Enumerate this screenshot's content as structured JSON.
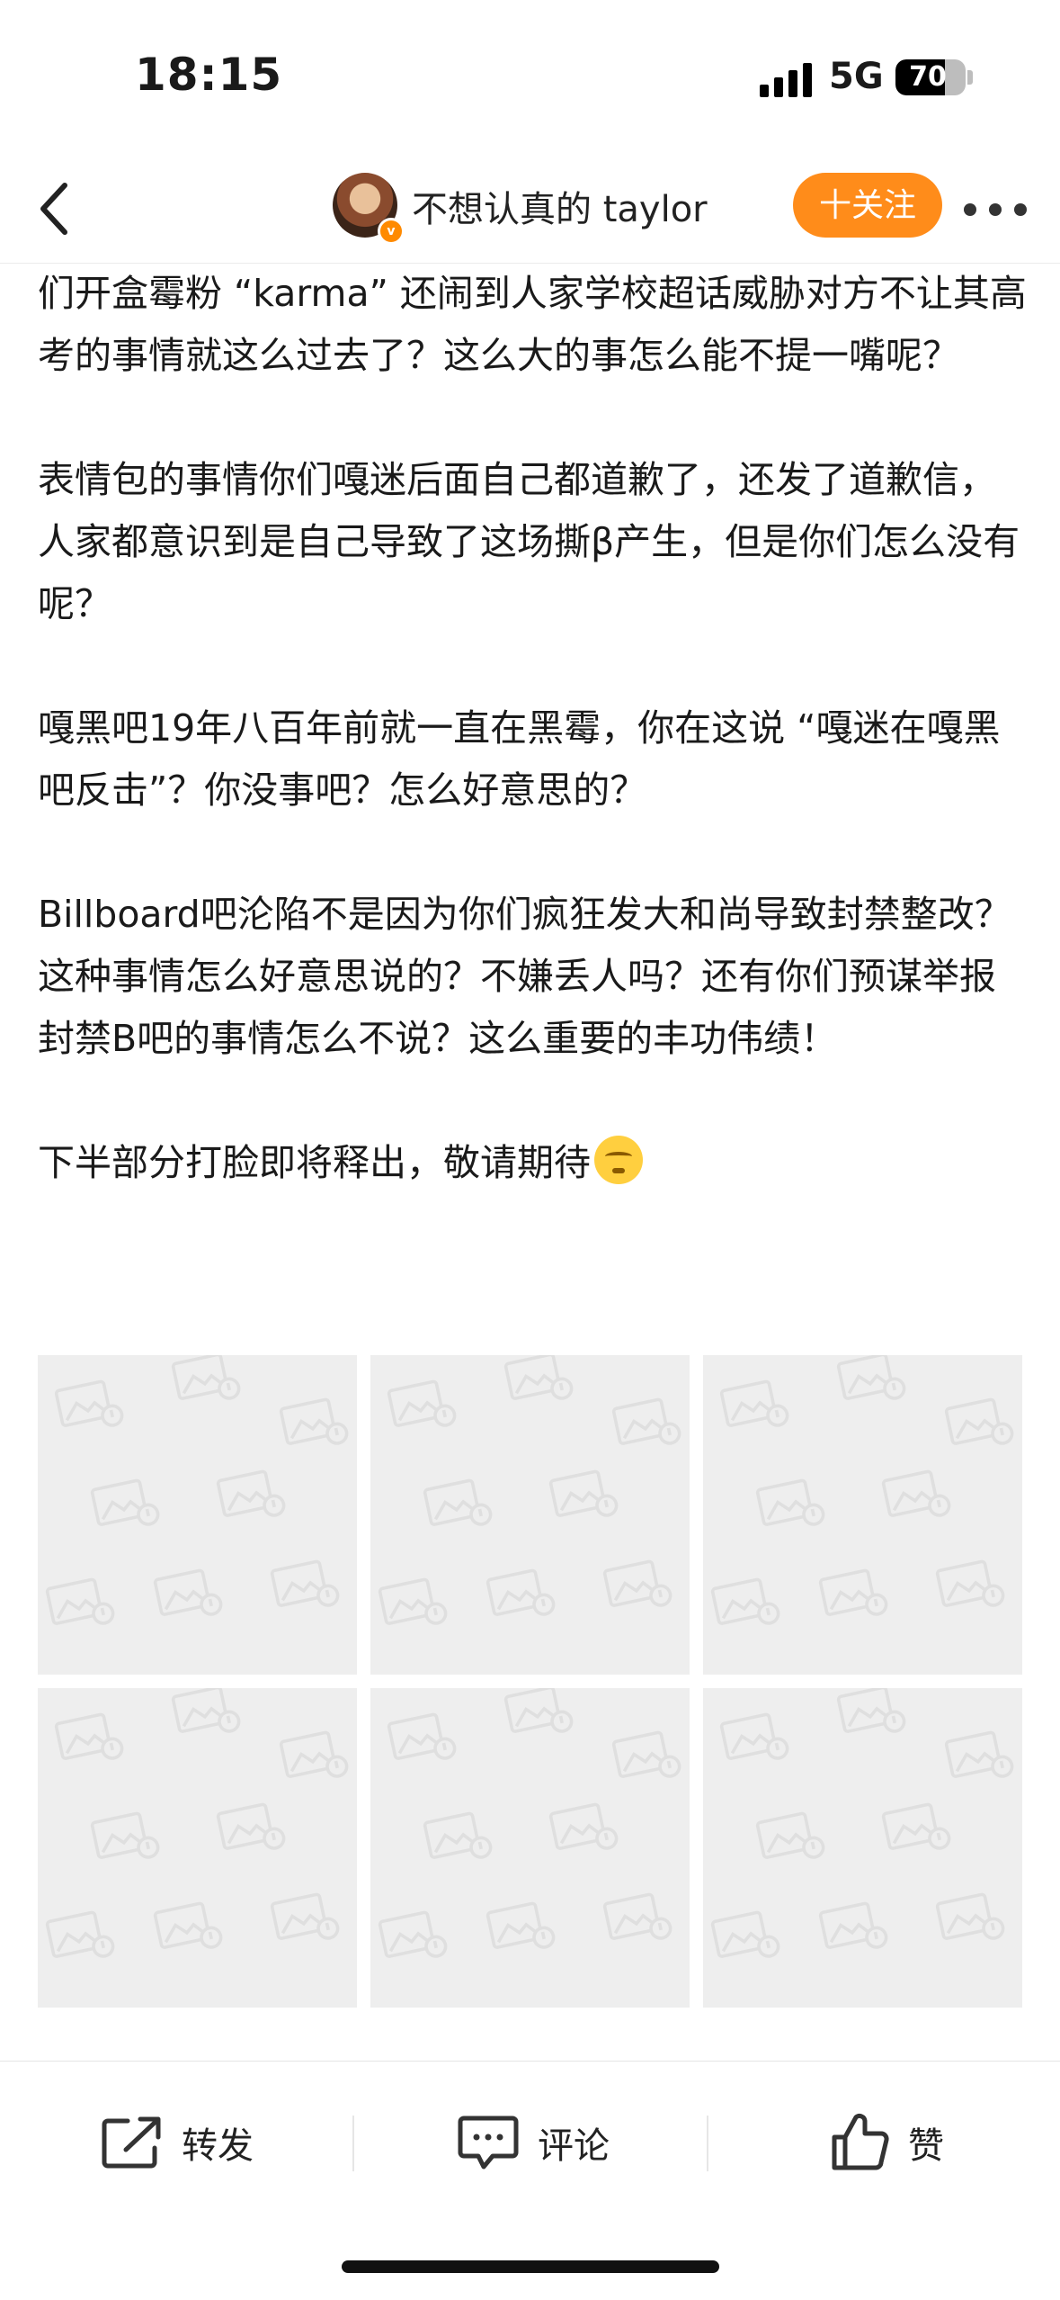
{
  "status_bar": {
    "time": "18:15",
    "network": "5G",
    "battery": "70",
    "battery_level": 0.7
  },
  "header": {
    "author": "不想认真的 taylor",
    "follow_label": "十关注",
    "icons": [
      "back-icon",
      "more-icon",
      "verified-badge-icon"
    ]
  },
  "post": {
    "paragraphs": [
      "们开盒霉粉 “karma” 还闹到人家学校超话威胁对方不让其高考的事情就这么过去了？这么大的事怎么能不提一嘴呢？",
      "表情包的事情你们嘎迷后面自己都道歉了，还发了道歉信，人家都意识到是自己导致了这场撕β产生，但是你们怎么没有呢？",
      "嘎黑吧19年八百年前就一直在黑霉，你在这说 “嘎迷在嘎黑吧反击”？你没事吧？怎么好意思的？",
      "Billboard吧沦陷不是因为你们疯狂发大和尚导致封禁整改？这种事情怎么好意思说的？不嫌丢人吗？还有你们预谋举报封禁B吧的事情怎么不说？这么重要的丰功伟绩！",
      "下半部分打脸即将释出，敬请期待"
    ],
    "emoji": "shushing-face-emoji",
    "image_count": 6
  },
  "actions": {
    "repost": "转发",
    "comment": "评论",
    "like": "赞"
  }
}
